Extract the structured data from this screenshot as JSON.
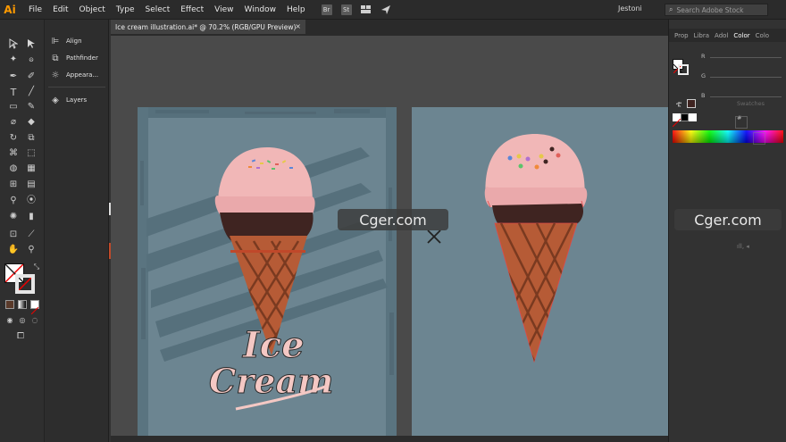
{
  "app": {
    "logo": "Ai",
    "accent": "#ff9a00"
  },
  "menu": {
    "items": [
      "File",
      "Edit",
      "Object",
      "Type",
      "Select",
      "Effect",
      "View",
      "Window",
      "Help"
    ]
  },
  "menubar_icons": [
    "br-icon",
    "st-icon",
    "workspace-icon",
    "send-icon"
  ],
  "user": {
    "name": "Jestoni"
  },
  "search": {
    "placeholder": "Search Adobe Stock"
  },
  "document": {
    "tab_title": "Ice cream illustration.ai* @ 70.2% (RGB/GPU Preview)",
    "close": "×"
  },
  "panels": {
    "items": [
      {
        "label": "Align",
        "icon": "align-icon"
      },
      {
        "label": "Pathfinder",
        "icon": "pathfinder-icon"
      },
      {
        "label": "Appeara...",
        "icon": "appearance-icon"
      },
      {
        "label": "Layers",
        "icon": "layers-icon"
      }
    ]
  },
  "right_panel": {
    "tabs": [
      "Prop",
      "Libra",
      "Adol",
      "Color",
      "Colo"
    ],
    "active_tab": "Color",
    "channels": [
      "R",
      "G",
      "B"
    ],
    "hash": "#",
    "swatches_label": "Swatches"
  },
  "artboard": {
    "title_text_line1": "Ice",
    "title_text_line2": "Cream",
    "background": "#6c8591"
  },
  "watermarks": [
    "Cger.com",
    "Cger.com"
  ],
  "colors": {
    "scoop": "#f1b7b7",
    "chocolate": "#3f2421",
    "cone": "#b65b36",
    "stripe": "#536a76",
    "title_fill": "#f4c8c4"
  }
}
